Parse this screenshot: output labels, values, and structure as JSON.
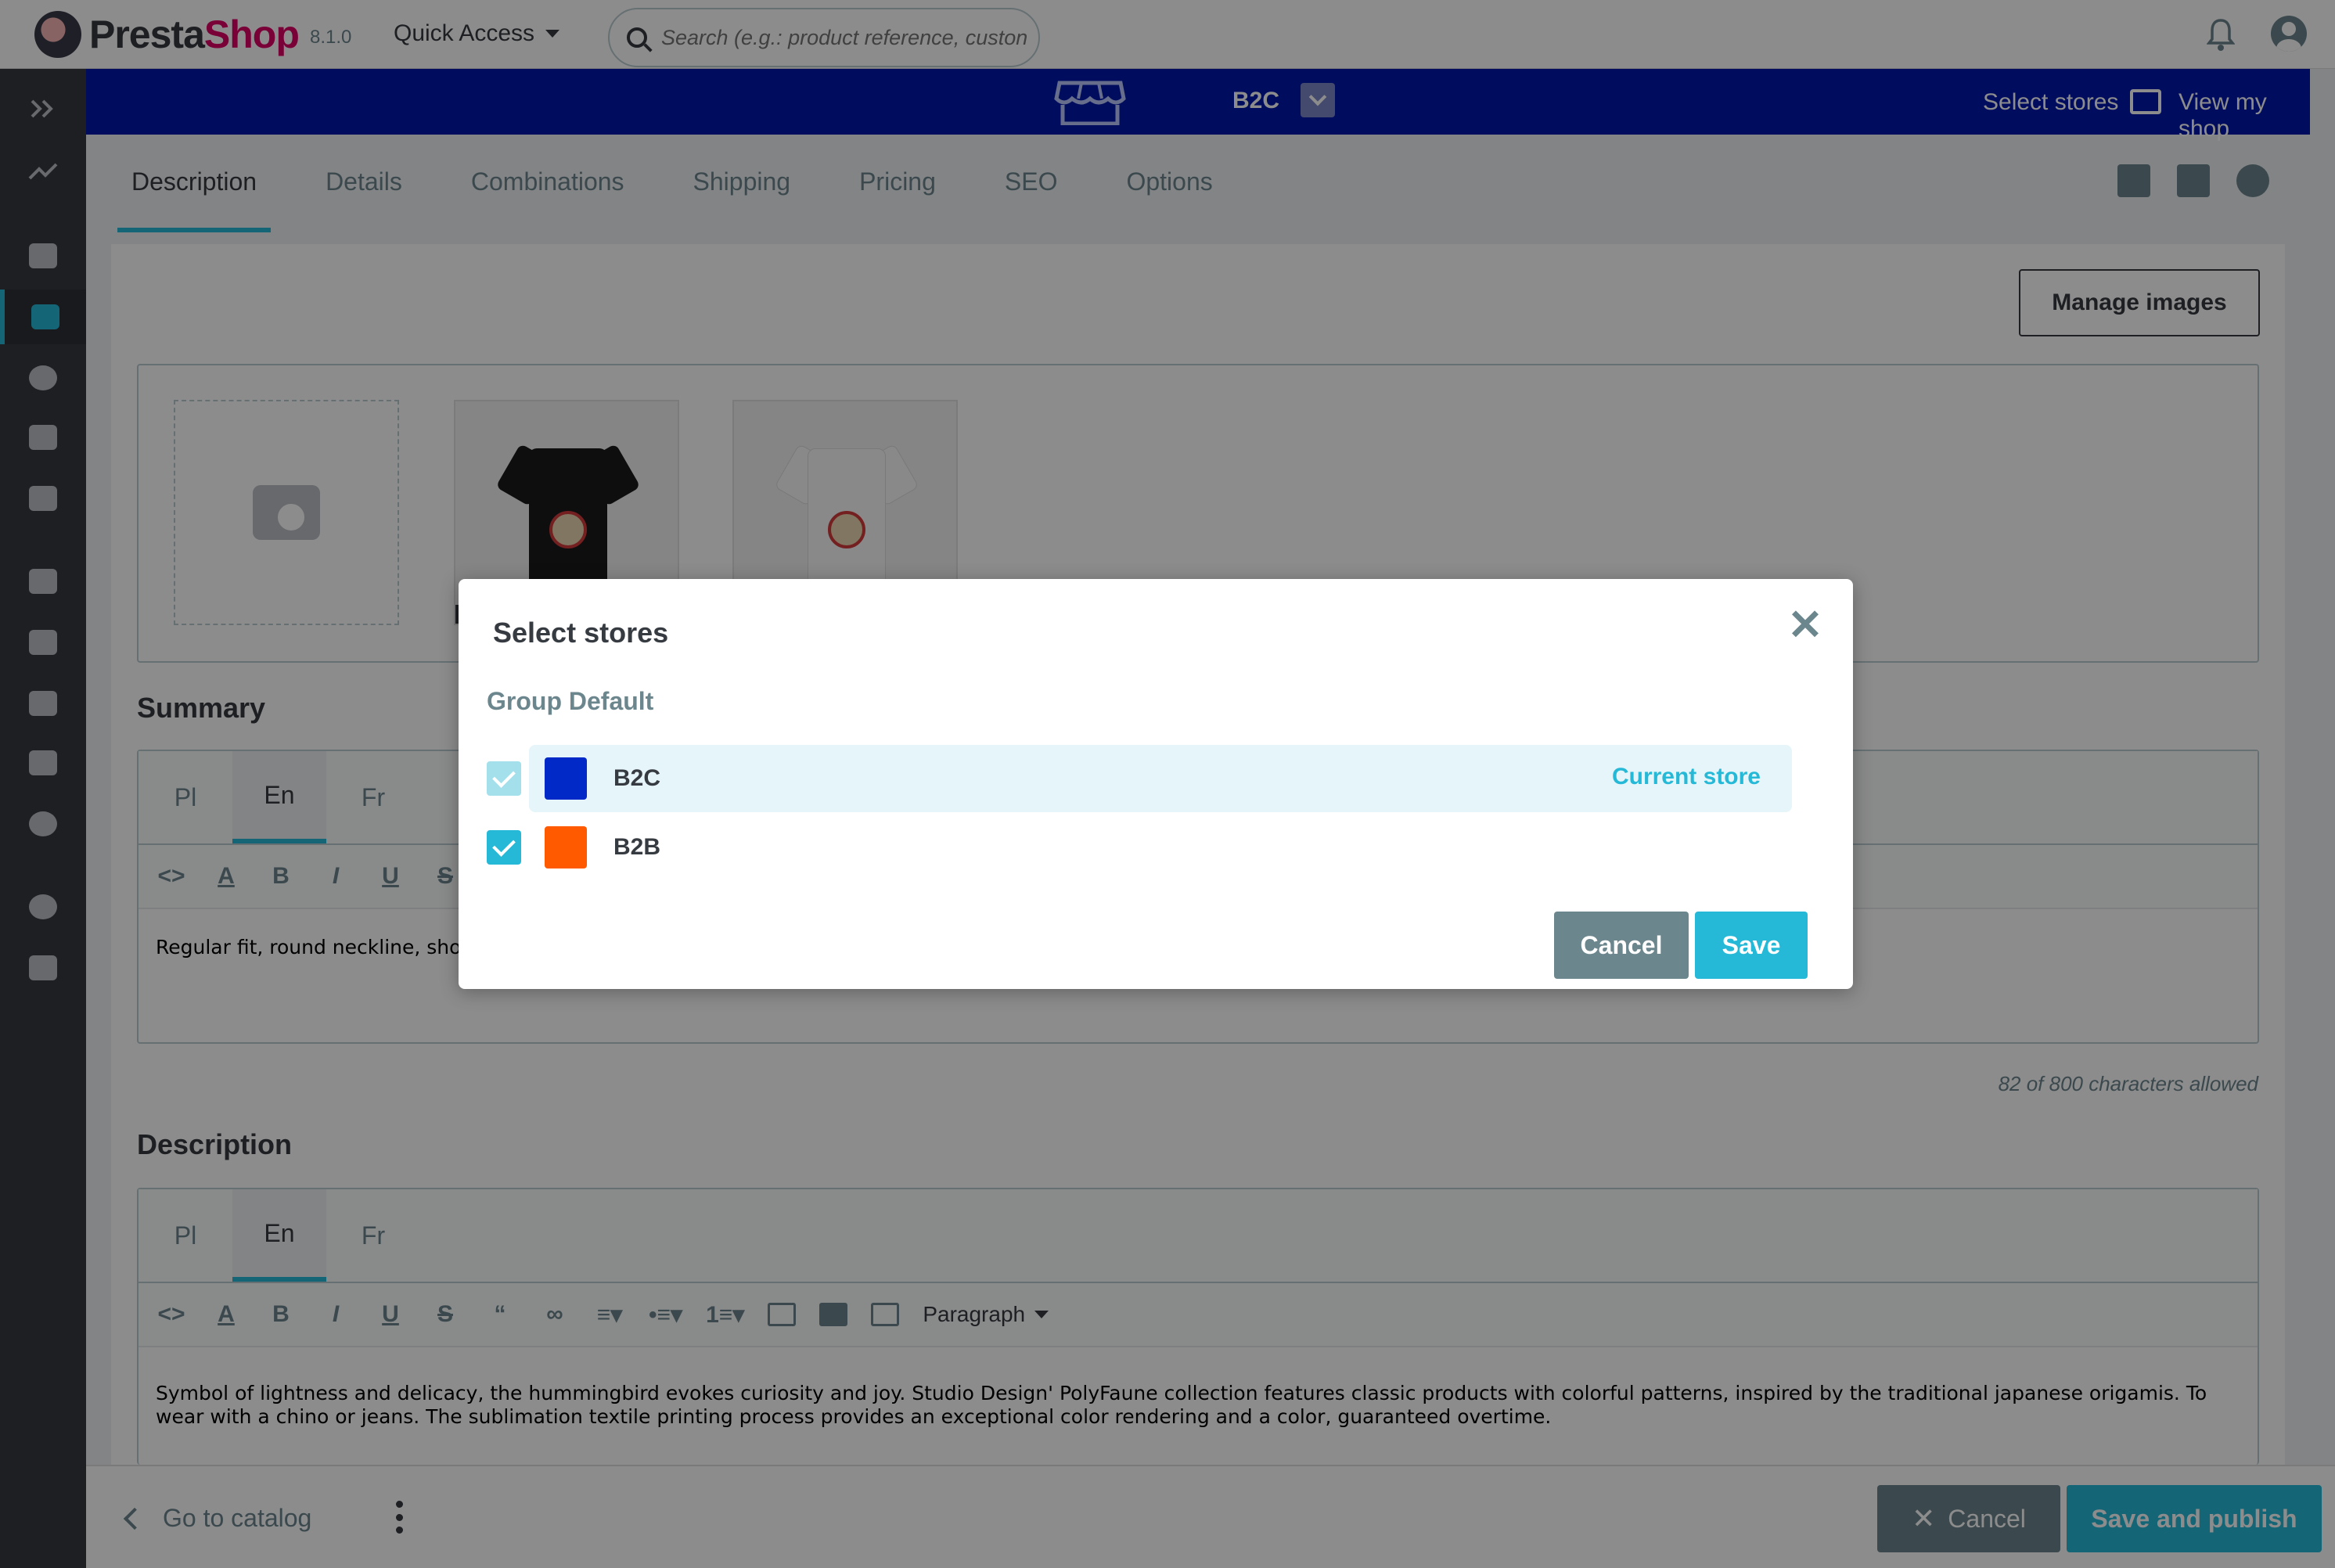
{
  "header": {
    "brand_prefix": "Presta",
    "brand_suffix": "Shop",
    "version": "8.1.0",
    "quick_access": "Quick Access",
    "search_placeholder": "Search (e.g.: product reference, custon"
  },
  "sidebar": {
    "items": [
      {
        "icon": "expand-icon"
      },
      {
        "icon": "dashboard-trend-icon"
      },
      {
        "icon": "orders-basket-icon"
      },
      {
        "icon": "catalog-store-icon",
        "active": true
      },
      {
        "icon": "customers-icon"
      },
      {
        "icon": "customer-service-icon"
      },
      {
        "icon": "stats-icon"
      },
      {
        "icon": "modules-puzzle-icon"
      },
      {
        "icon": "design-monitor-icon"
      },
      {
        "icon": "shipping-truck-icon"
      },
      {
        "icon": "payment-card-icon"
      },
      {
        "icon": "international-globe-icon"
      },
      {
        "icon": "settings-gear-icon"
      },
      {
        "icon": "advanced-settings-icon"
      }
    ]
  },
  "storebar": {
    "store_name": "B2C",
    "select_stores": "Select stores",
    "view_my_shop": "View my shop",
    "color": "#0018ad"
  },
  "tabs": [
    "Description",
    "Details",
    "Combinations",
    "Shipping",
    "Pricing",
    "SEO",
    "Options"
  ],
  "main": {
    "manage_images": "Manage images",
    "summary_title": "Summary",
    "summary_langs": [
      "Pl",
      "En",
      "Fr"
    ],
    "summary_text": "Regular fit, round neckline, shor",
    "char_count": "82 of 800 characters allowed",
    "description_title": "Description",
    "description_langs": [
      "Pl",
      "En",
      "Fr"
    ],
    "paragraph_label": "Paragraph",
    "description_text": "Symbol of lightness and delicacy, the hummingbird evokes curiosity and joy. Studio Design' PolyFaune collection features classic products with colorful patterns, inspired by the traditional japanese origamis. To wear with a chino or jeans. The sublimation textile printing process provides an exceptional color rendering and a color, guaranteed overtime."
  },
  "footer": {
    "go_to_catalog": "Go to catalog",
    "cancel": "Cancel",
    "save_and_publish": "Save and publish"
  },
  "modal": {
    "title": "Select stores",
    "group": "Group Default",
    "stores": [
      {
        "name": "B2C",
        "color": "#0029c7",
        "checked": true,
        "current": true,
        "current_label": "Current store"
      },
      {
        "name": "B2B",
        "color": "#ff5a00",
        "checked": true,
        "current": false
      }
    ],
    "cancel": "Cancel",
    "save": "Save"
  },
  "colors": {
    "accent": "#25b9d7",
    "secondary": "#6c868e",
    "sidebar": "#363a41"
  }
}
